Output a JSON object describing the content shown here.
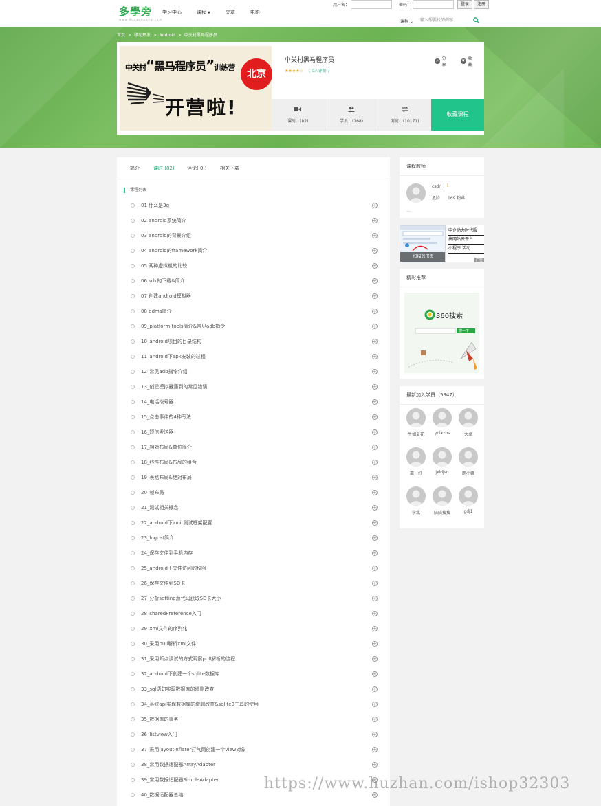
{
  "header": {
    "logo": "多學旁",
    "logo_sub": "www.duoxuepang.com",
    "nav": [
      {
        "label": "学习中心",
        "has_caret": false
      },
      {
        "label": "课程",
        "has_caret": true
      },
      {
        "label": "文章",
        "has_caret": false
      },
      {
        "label": "电影",
        "has_caret": false
      }
    ],
    "login": {
      "username_label": "用户名：",
      "password_label": "密码：",
      "login_button": "登录",
      "register_button": "注册"
    },
    "search": {
      "category": "课程",
      "placeholder": "输入想要找的内容"
    }
  },
  "breadcrumb": [
    "首页",
    ">",
    "移动开发",
    ">",
    "Android",
    ">",
    "中关村黑马程序员"
  ],
  "course": {
    "image_title_pre": "中关村",
    "image_title_main": "黑马程序员",
    "image_title_post": "训练营",
    "image_big": "开营啦!",
    "image_badge": "北京",
    "name": "中关村黑马程序员",
    "stars": "★★★★☆",
    "rating_count": "( 0人评价 )",
    "share_label": "分享",
    "collect_label": "收藏",
    "stats": [
      {
        "icon": "video-icon",
        "label": "课时：(82)"
      },
      {
        "icon": "students-icon",
        "label": "学员：(168)"
      },
      {
        "icon": "views-icon",
        "label": "浏览：(10171)"
      }
    ],
    "collect_button": "收藏课程"
  },
  "tabs": [
    {
      "label": "简介",
      "active": false
    },
    {
      "label": "课时 (82)",
      "active": true
    },
    {
      "label": "评论( 0 )",
      "active": false
    },
    {
      "label": "相关下载",
      "active": false
    }
  ],
  "section_title": "课程列表",
  "lessons": [
    "01 什么是3g",
    "02 android系统简介",
    "03 android的背景介绍",
    "04 android的framework简介",
    "05 两种虚拟机的比较",
    "06 sdk的下载&简介",
    "07 创建android模拟器",
    "08 ddms简介",
    "09_platform-tools简介&常见adb指令",
    "10_android项目的目录结构",
    "11_android下apk安装的过程",
    "12_常见adb指令介绍",
    "13_创建模拟器遇到的常见错误",
    "14_电话拨号器",
    "15_点击事件的4种写法",
    "16_短信发送器",
    "17_相对布局&单位简介",
    "18_线性布局&布局的组合",
    "19_表格布局&绝对布局",
    "20_帧布局",
    "21_测试相关概念",
    "22_android下junit测试框架配置",
    "23_logcat简介",
    "24_保存文件到手机内存",
    "25_android下文件访问的权限",
    "26_保存文件到SD卡",
    "27_分析setting源代码获取SD卡大小",
    "28_sharedPreference入门",
    "29_xml文件的序列化",
    "30_采用pull解析xml文件",
    "31_采用断点调试的方式观察pull解析的流程",
    "32_android下创建一个sqlite数据库",
    "33_sql语句实现数据库的增删改查",
    "34_系统api实现数据库的增删改查&sqlite3工具的使用",
    "35_数据库的事务",
    "36_listview入门",
    "37_采用layoutInflater打气筒创建一个view对象",
    "38_常用数据适配器ArrayAdapter",
    "39_常用数据适配器SimpleAdapter",
    "40_数据适配器总结"
  ],
  "sidebar": {
    "teacher_title": "课程教师",
    "teacher_name": "csdn",
    "teacher_rank": "危险",
    "teacher_fans": "169 粉丝",
    "teacher_more": "...",
    "ad_label": "扫描的书页",
    "ad_lines": [
      "中企动力时代服",
      "搞网站云平台",
      "小程序 活动"
    ],
    "ad_tag": "广告",
    "recommend_title": "精彩推荐",
    "recommend_logo": "360搜索",
    "recommend_button": "搜一下",
    "students_title": "最新加入学员（5947）",
    "students": [
      "生如夏花",
      "ynlxzbs",
      "大卓",
      "赢，好",
      "jxldjsn",
      "雨小峰",
      "李北",
      "陪陪搜搜",
      "gdj1"
    ]
  },
  "watermark": "https://www.huzhan.com/ishop32303",
  "colors": {
    "brand_green": "#21c48a",
    "banner_green": "#6cb354",
    "badge_red": "#e21d1d",
    "star": "#f0a20b"
  }
}
